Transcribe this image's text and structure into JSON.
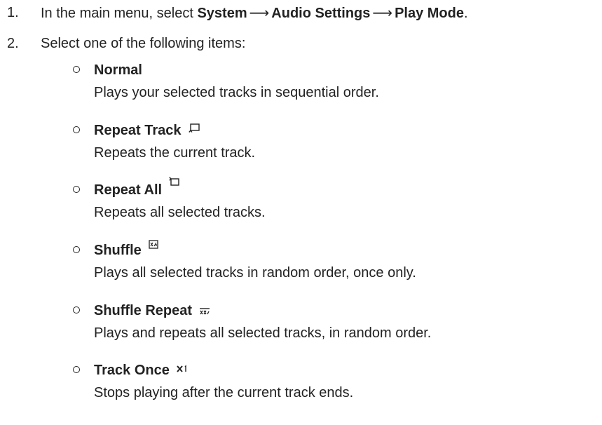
{
  "steps": [
    {
      "number": "1.",
      "text_prefix": "In the main menu, select ",
      "menu_path": [
        "System",
        "Audio Settings",
        "Play Mode"
      ],
      "arrow": "⟶",
      "text_suffix": "."
    },
    {
      "number": "2.",
      "text": "Select one of the following items:"
    }
  ],
  "options": [
    {
      "title": "Normal",
      "description": "Plays your selected tracks in sequential order.",
      "icon": ""
    },
    {
      "title": "Repeat Track",
      "description": "Repeats the current track.",
      "icon": "repeat-track-icon"
    },
    {
      "title": "Repeat All",
      "description": "Repeats all selected tracks.",
      "icon": "repeat-all-icon"
    },
    {
      "title": "Shuffle",
      "description": "Plays all selected tracks in random order, once only.",
      "icon": "shuffle-icon"
    },
    {
      "title": "Shuffle Repeat",
      "description": "Plays and repeats all selected tracks, in random order.",
      "icon": "shuffle-repeat-icon"
    },
    {
      "title": "Track Once",
      "description": "Stops playing after the current track ends.",
      "icon": "track-once-icon"
    }
  ]
}
